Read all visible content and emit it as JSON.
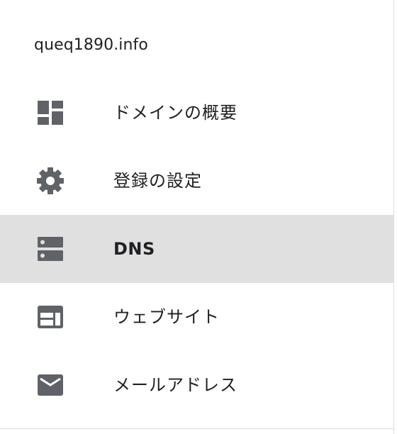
{
  "domain_name": "queq1890.info",
  "nav": {
    "items": [
      {
        "label": "ドメインの概要",
        "icon": "dashboard-icon",
        "selected": false
      },
      {
        "label": "登録の設定",
        "icon": "gear-icon",
        "selected": false
      },
      {
        "label": "DNS",
        "icon": "dns-icon",
        "selected": true
      },
      {
        "label": "ウェブサイト",
        "icon": "web-icon",
        "selected": false
      },
      {
        "label": "メールアドレス",
        "icon": "mail-icon",
        "selected": false
      }
    ]
  },
  "colors": {
    "icon": "#5f6368",
    "selected_bg": "#e0e0e0",
    "text": "#202124"
  }
}
